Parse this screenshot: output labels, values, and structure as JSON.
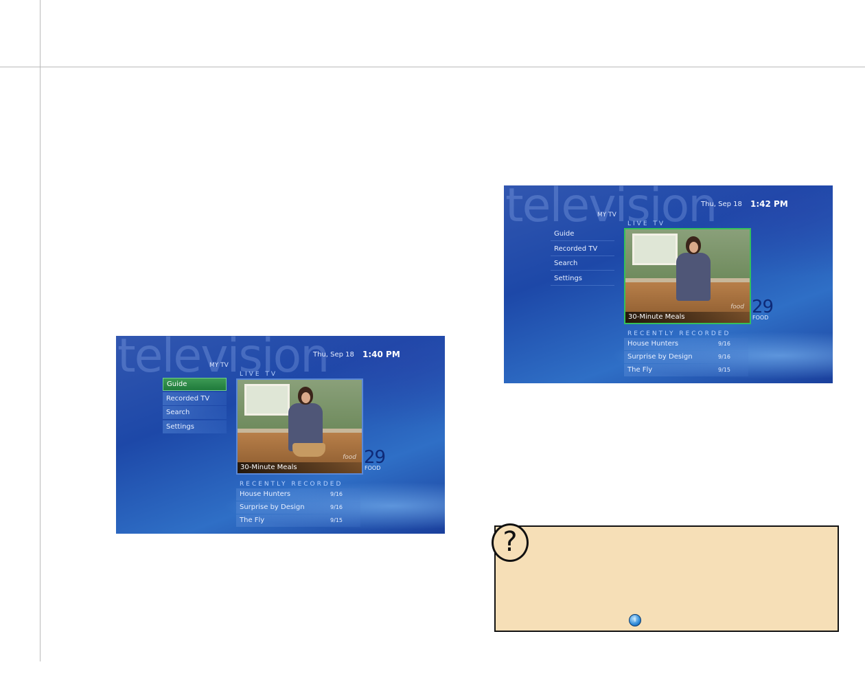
{
  "screen1": {
    "watermark": "television",
    "date": "Thu, Sep 18",
    "time": "1:40 PM",
    "section": "MY TV",
    "menu": [
      "Guide",
      "Recorded TV",
      "Search",
      "Settings"
    ],
    "selected_menu": "Guide",
    "live_label": "LIVE TV",
    "now_playing": "30-Minute Meals",
    "channel_number": "29",
    "channel_name": "FOOD",
    "recent_label": "RECENTLY RECORDED",
    "recordings": [
      {
        "title": "House Hunters",
        "date": "9/16"
      },
      {
        "title": "Surprise by Design",
        "date": "9/16"
      },
      {
        "title": "The Fly",
        "date": "9/15"
      }
    ],
    "logo": "food"
  },
  "screen2": {
    "watermark": "television",
    "date": "Thu, Sep 18",
    "time": "1:42 PM",
    "section": "MY TV",
    "menu": [
      "Guide",
      "Recorded TV",
      "Search",
      "Settings"
    ],
    "live_label": "LIVE TV",
    "now_playing": "30-Minute Meals",
    "channel_number": "29",
    "channel_name": "FOOD",
    "recent_label": "RECENTLY RECORDED",
    "recordings": [
      {
        "title": "House Hunters",
        "date": "9/16"
      },
      {
        "title": "Surprise by Design",
        "date": "9/16"
      },
      {
        "title": "The Fly",
        "date": "9/15"
      }
    ],
    "logo": "food"
  },
  "tip": {
    "question_glyph": "?",
    "inline_icon_glyph": "i"
  }
}
